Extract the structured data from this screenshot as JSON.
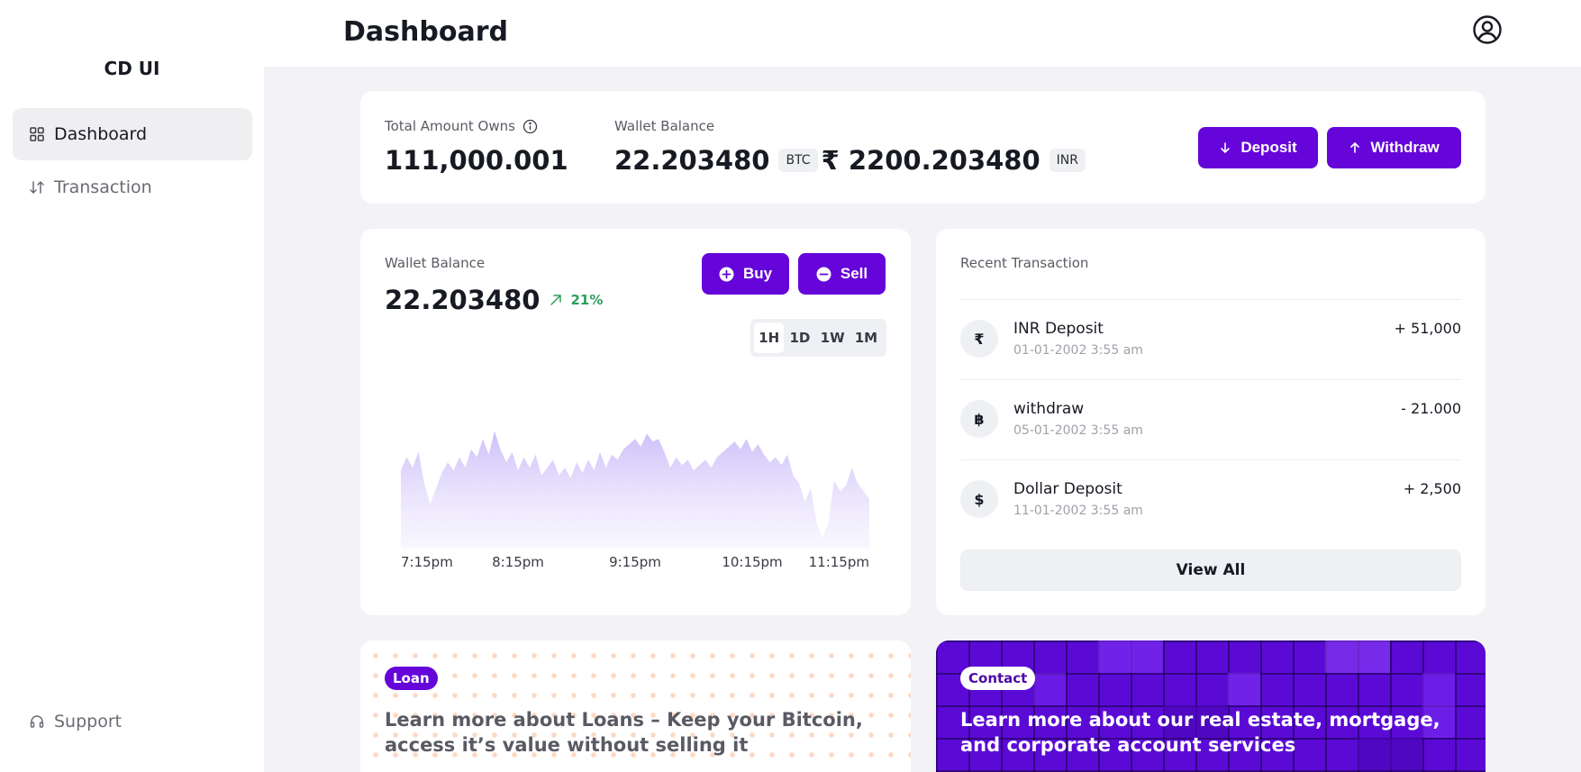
{
  "sidebar": {
    "brand": "CD UI",
    "items": [
      {
        "label": "Dashboard",
        "icon": "grid-icon",
        "active": true
      },
      {
        "label": "Transaction",
        "icon": "arrows-up-down-icon",
        "active": false
      }
    ],
    "support": {
      "label": "Support",
      "icon": "headset-icon"
    }
  },
  "header": {
    "title": "Dashboard",
    "avatar_icon": "user-circle-icon"
  },
  "summary": {
    "total_label": "Total Amount Owns",
    "total_value": "111,000.001",
    "wallet_label": "Wallet Balance",
    "btc_value": "22.203480",
    "btc_tag": "BTC",
    "inr_value": "₹ 2200.203480",
    "inr_tag": "INR",
    "deposit_label": "Deposit",
    "withdraw_label": "Withdraw"
  },
  "wallet_chart": {
    "label": "Wallet Balance",
    "value": "22.203480",
    "change": "21%",
    "buy_label": "Buy",
    "sell_label": "Sell",
    "ranges": [
      "1H",
      "1D",
      "1W",
      "1M"
    ],
    "active_range": "1H"
  },
  "chart_data": {
    "type": "area",
    "title": "",
    "xlabel": "",
    "ylabel": "",
    "categories": [
      "7:15pm",
      "8:15pm",
      "9:15pm",
      "10:15pm",
      "11:15pm"
    ],
    "grid": false,
    "series": [
      {
        "values": [
          60,
          70,
          62,
          74,
          50,
          34,
          46,
          58,
          66,
          60,
          70,
          62,
          76,
          70,
          84,
          72,
          90,
          76,
          66,
          74,
          60,
          70,
          62,
          72,
          56,
          62,
          68,
          56,
          62,
          54,
          66,
          58,
          68,
          60,
          74,
          62,
          72,
          68,
          76,
          80,
          84,
          78,
          88,
          82,
          84,
          74,
          62,
          70,
          64,
          68,
          60,
          64,
          68,
          62,
          70,
          74,
          78,
          82,
          76,
          84,
          74,
          80,
          72,
          66,
          70,
          64,
          72,
          56,
          50,
          36,
          46,
          20,
          8,
          20,
          52,
          44,
          48,
          62,
          50,
          44,
          38
        ],
        "color": "#c8b8f8"
      }
    ]
  },
  "recent": {
    "title": "Recent Transaction",
    "items": [
      {
        "icon": "₹",
        "icon_name": "rupee-icon",
        "title": "INR Deposit",
        "date": "01-01-2002 3:55 am",
        "amount": "+ 51,000"
      },
      {
        "icon": "฿",
        "icon_name": "bitcoin-icon",
        "title": "withdraw",
        "date": "05-01-2002 3:55 am",
        "amount": "- 21.000"
      },
      {
        "icon": "$",
        "icon_name": "dollar-icon",
        "title": "Dollar Deposit",
        "date": "11-01-2002 3:55 am",
        "amount": "+ 2,500"
      }
    ],
    "view_all": "View All"
  },
  "promo": {
    "loan_tag": "Loan",
    "loan_text": "Learn more about Loans – Keep your Bitcoin, access it’s value without selling it",
    "contact_tag": "Contact",
    "contact_text": "Learn more about our real estate, mortgage, and corporate account services"
  },
  "colors": {
    "accent": "#6505d9",
    "positive": "#2e9e5b",
    "page_bg": "#f3f3f7"
  }
}
